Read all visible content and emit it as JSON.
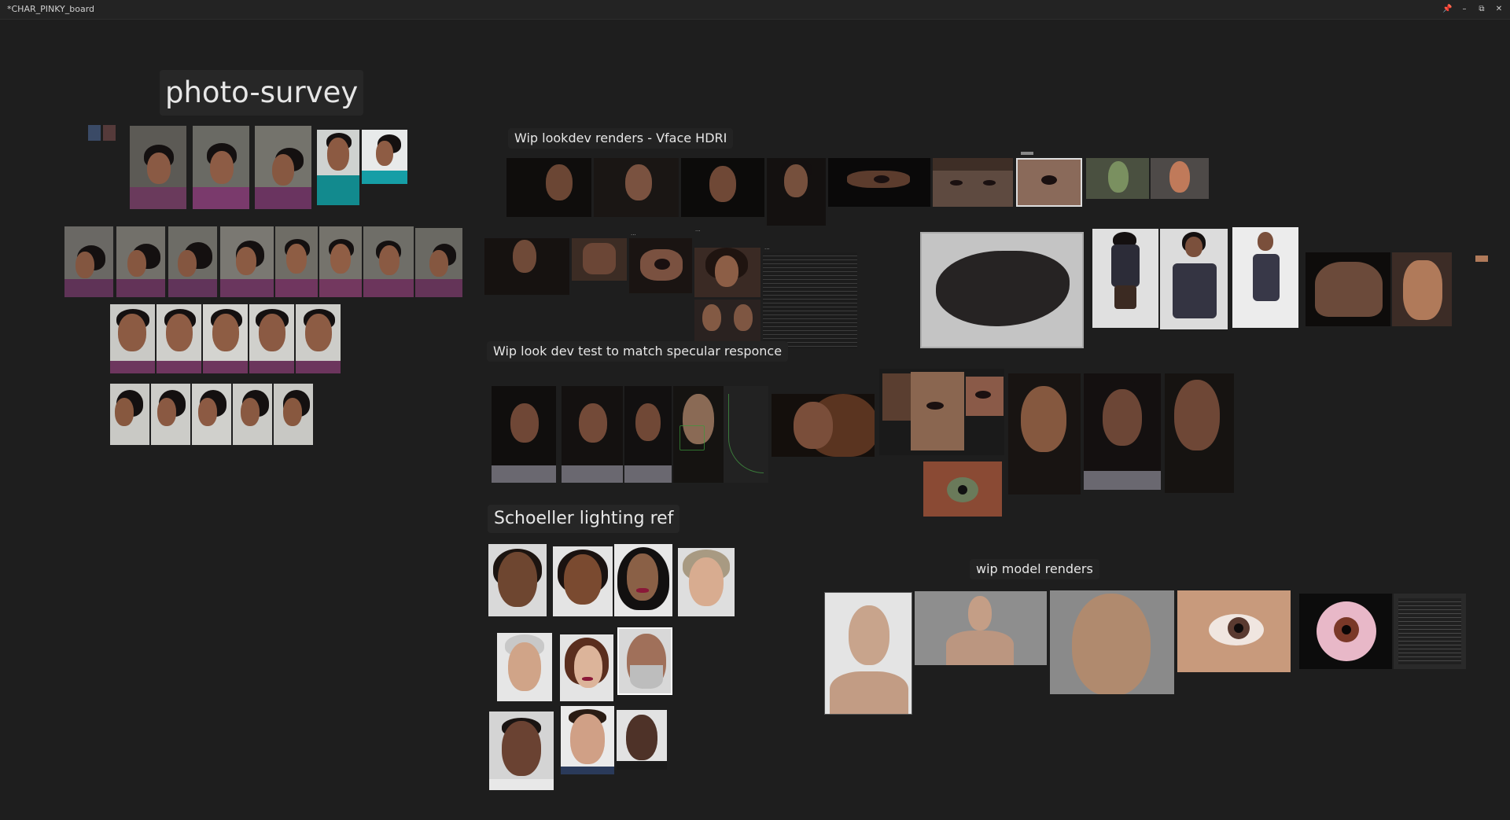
{
  "window": {
    "title": "*CHAR_PINKY_board",
    "buttons": [
      "pin",
      "minimize",
      "maximize",
      "close"
    ]
  },
  "board": {
    "labels": {
      "photo_survey": "photo-survey",
      "lookdev_vface": "Wip lookdev renders - Vface HDRI",
      "lookdev_specular": "Wip look dev test to match specular responce",
      "schoeller": "Schoeller lighting ref",
      "model_renders": "wip model renders"
    },
    "notes": {
      "annotation_a": "...",
      "annotation_b": "...",
      "annotation_c": "..."
    }
  },
  "colors": {
    "background": "#1e1e1e",
    "label_bg": "#262626",
    "label_text": "#e6e6e6"
  }
}
